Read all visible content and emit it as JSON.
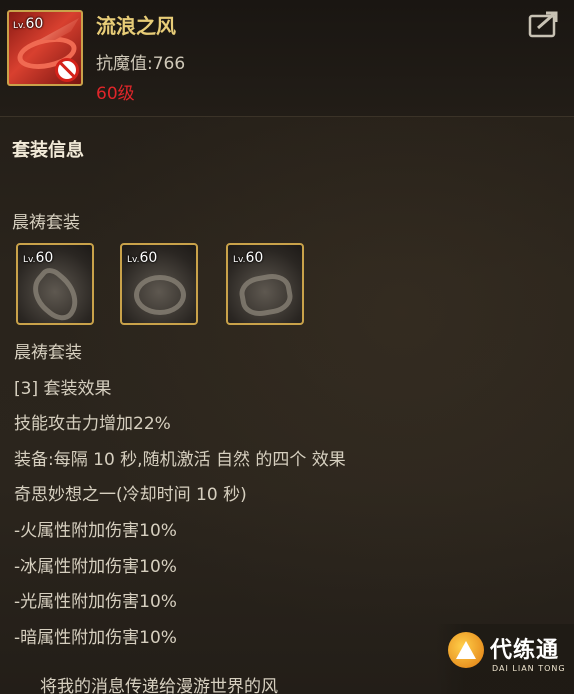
{
  "item": {
    "level_prefix": "Lv.",
    "level": "60",
    "name": "流浪之风",
    "stat": "抗魔值:766",
    "level_requirement": "60级",
    "icon": "red-ring-of-wind"
  },
  "set_info": {
    "section_title": "套装信息",
    "set_name": "晨祷套装",
    "pieces": [
      {
        "level_prefix": "Lv.",
        "level": "60",
        "icon": "wrist-gauntlet"
      },
      {
        "level_prefix": "Lv.",
        "level": "60",
        "icon": "chain-necklace"
      },
      {
        "level_prefix": "Lv.",
        "level": "60",
        "icon": "winged-ring"
      }
    ]
  },
  "description": {
    "lines": [
      "晨祷套装",
      "[3] 套装效果",
      "技能攻击力增加22%",
      "装备:每隔 10 秒,随机激活 自然 的四个 效果",
      "奇思妙想之一(冷却时间 10 秒)",
      "-火属性附加伤害10%",
      "-冰属性附加伤害10%",
      "-光属性附加伤害10%",
      "-暗属性附加伤害10%"
    ],
    "footer": "将我的消息传递给漫游世界的风"
  },
  "watermark": {
    "text": "代练通",
    "subtext": "DAI LIAN TONG"
  },
  "colors": {
    "item_name": "#e8cd78",
    "level_requirement": "#e0262a",
    "frame_gold": "#c9a24a"
  }
}
